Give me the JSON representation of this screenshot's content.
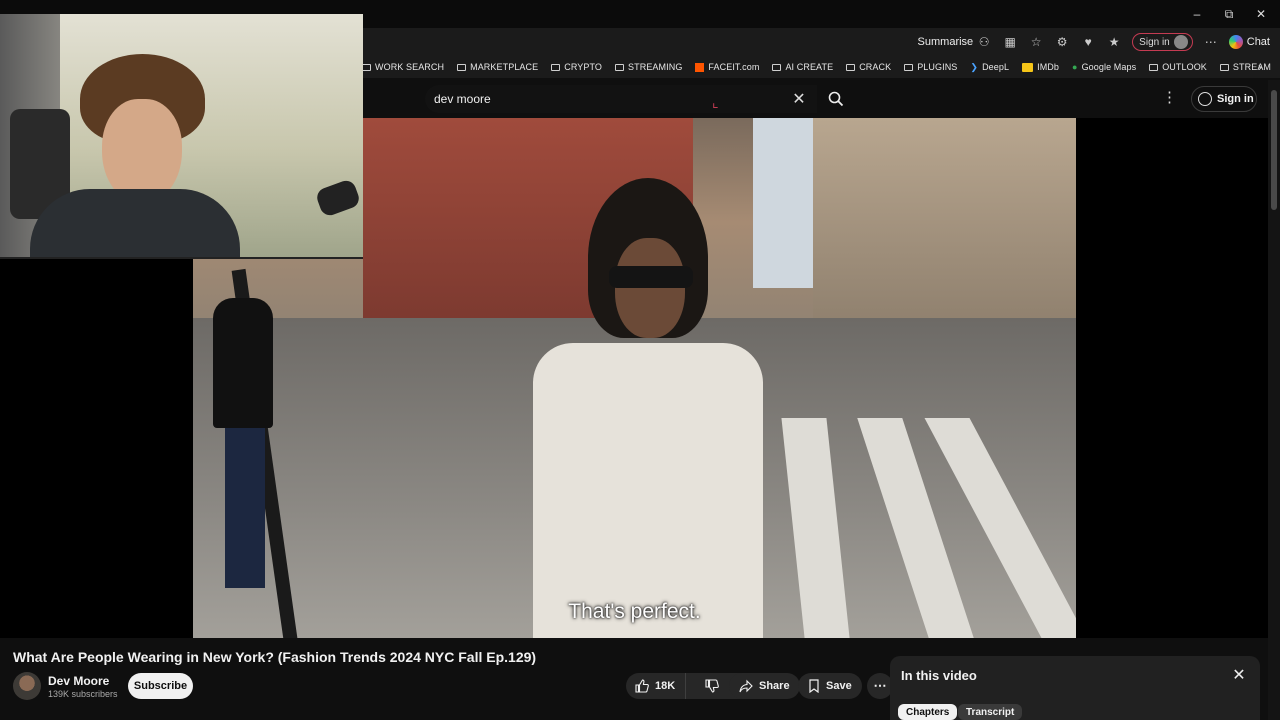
{
  "browser": {
    "summarise_label": "Summarise",
    "sign_in_label": "Sign in",
    "chat_label": "Chat",
    "bookmarks": [
      {
        "label": "WORK SEARCH",
        "icon": "folder-icon"
      },
      {
        "label": "MARKETPLACE",
        "icon": "folder-icon"
      },
      {
        "label": "CRYPTO",
        "icon": "folder-icon"
      },
      {
        "label": "STREAMING",
        "icon": "folder-icon"
      },
      {
        "label": "FACEIT.com",
        "icon": "faceit-icon"
      },
      {
        "label": "AI CREATE",
        "icon": "folder-icon"
      },
      {
        "label": "CRACK",
        "icon": "folder-icon"
      },
      {
        "label": "PLUGINS",
        "icon": "folder-icon"
      },
      {
        "label": "DeepL",
        "icon": "deepl-icon"
      },
      {
        "label": "IMDb",
        "icon": "imdb-icon"
      },
      {
        "label": "Google Maps",
        "icon": "maps-icon"
      },
      {
        "label": "OUTLOOK",
        "icon": "folder-icon"
      },
      {
        "label": "STREAM",
        "icon": "folder-icon"
      }
    ]
  },
  "youtube": {
    "search_value": "dev moore",
    "sign_in_label": "Sign in"
  },
  "video": {
    "subtitle": "That's perfect.",
    "title": "What Are People Wearing in New York? (Fashion Trends 2024 NYC Fall Ep.129)"
  },
  "channel": {
    "name": "Dev Moore",
    "subscribers": "139K subscribers",
    "subscribe_label": "Subscribe"
  },
  "actions": {
    "likes": "18K",
    "share_label": "Share",
    "save_label": "Save"
  },
  "panel": {
    "title": "In this video",
    "chips": [
      "Chapters",
      "Transcript"
    ]
  },
  "colors": {
    "accent_pink": "#c43b52",
    "background": "#0f0f0f"
  }
}
